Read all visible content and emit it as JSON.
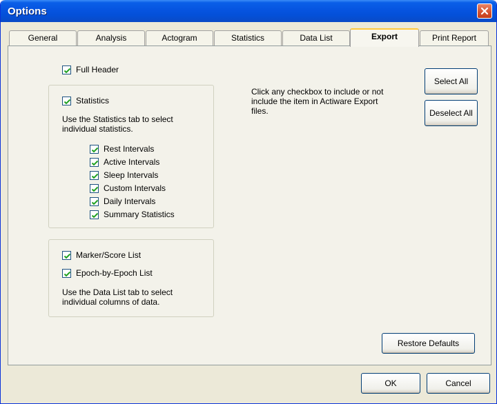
{
  "window": {
    "title": "Options"
  },
  "tabs": [
    {
      "label": "General",
      "active": false
    },
    {
      "label": "Analysis",
      "active": false
    },
    {
      "label": "Actogram",
      "active": false
    },
    {
      "label": "Statistics",
      "active": false
    },
    {
      "label": "Data List",
      "active": false
    },
    {
      "label": "Export",
      "active": true
    },
    {
      "label": "Print Report",
      "active": false
    }
  ],
  "export": {
    "full_header": {
      "label": "Full Header",
      "checked": true
    },
    "statistics": {
      "label": "Statistics",
      "checked": true,
      "note": "Use the Statistics tab to select individual statistics.",
      "items": [
        {
          "label": "Rest Intervals",
          "checked": true
        },
        {
          "label": "Active Intervals",
          "checked": true
        },
        {
          "label": "Sleep Intervals",
          "checked": true
        },
        {
          "label": "Custom Intervals",
          "checked": true
        },
        {
          "label": "Daily Intervals",
          "checked": true
        },
        {
          "label": "Summary Statistics",
          "checked": true
        }
      ]
    },
    "data_list": {
      "marker_score": {
        "label": "Marker/Score List",
        "checked": true
      },
      "epoch_by_epoch": {
        "label": "Epoch-by-Epoch List",
        "checked": true
      },
      "note": "Use the Data List tab to select individual columns of data."
    },
    "help_text": "Click any checkbox to include or not include the item in Actiware Export files.",
    "select_all": "Select All",
    "deselect_all": "Deselect All",
    "restore_defaults": "Restore Defaults"
  },
  "footer": {
    "ok": "OK",
    "cancel": "Cancel"
  },
  "colors": {
    "titlebar": "#0654e0",
    "dialog_bg": "#ece9d8",
    "close": "#d4502e",
    "active_tab_highlight": "#ffc83c"
  }
}
